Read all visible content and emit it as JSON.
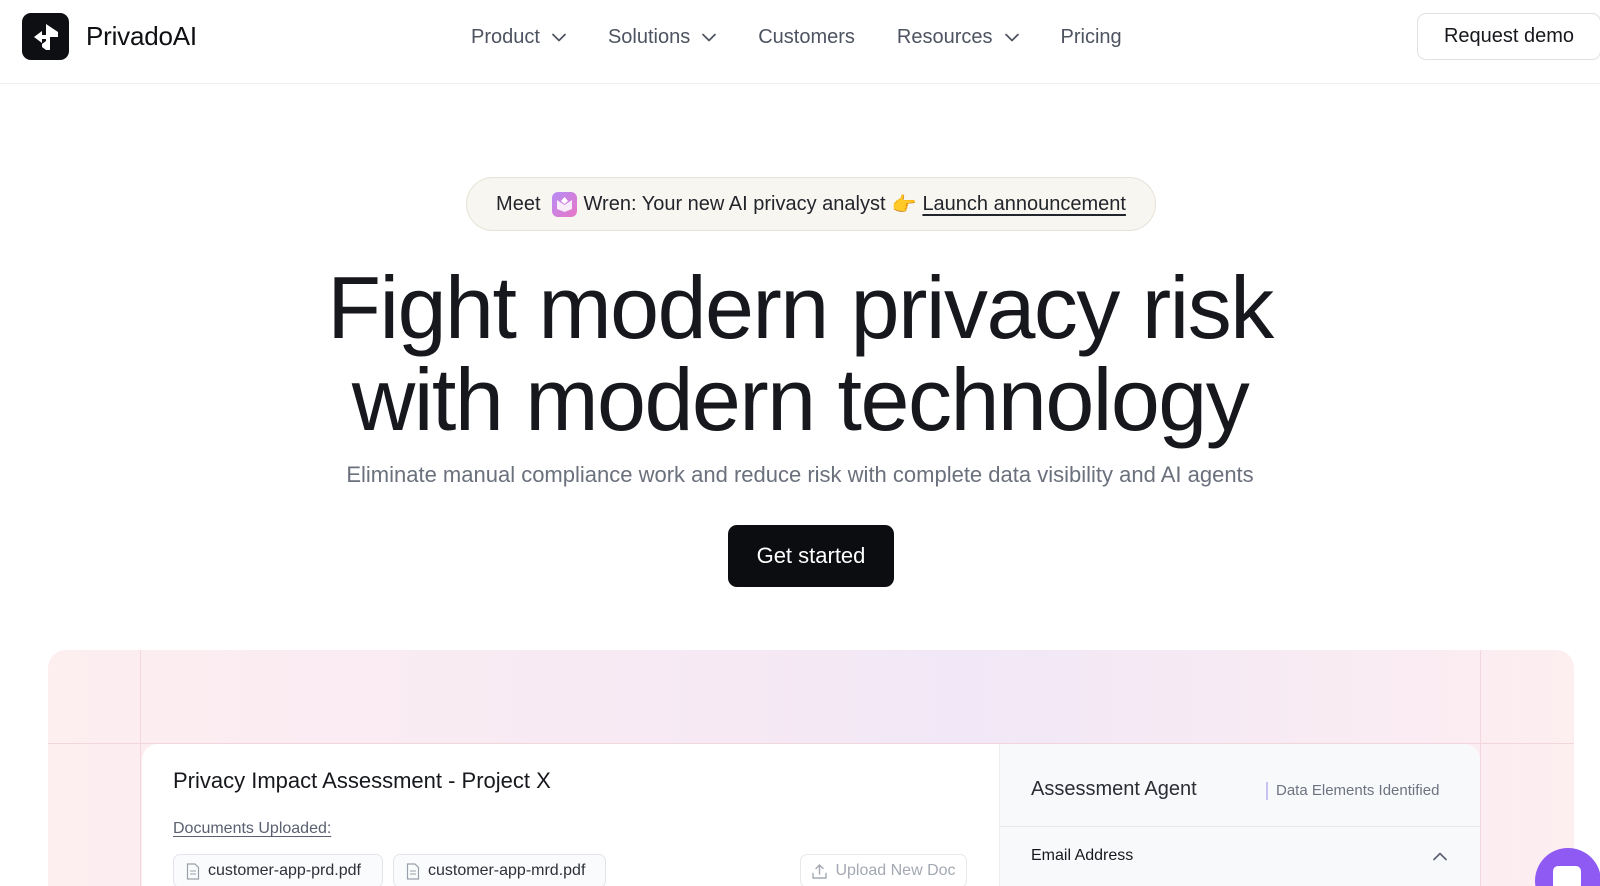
{
  "brand": {
    "name": "PrivadoAI"
  },
  "nav": {
    "items": [
      {
        "label": "Product",
        "has_dropdown": true
      },
      {
        "label": "Solutions",
        "has_dropdown": true
      },
      {
        "label": "Customers",
        "has_dropdown": false
      },
      {
        "label": "Resources",
        "has_dropdown": true
      },
      {
        "label": "Pricing",
        "has_dropdown": false
      }
    ],
    "request_demo": "Request demo"
  },
  "announcement": {
    "prefix": "Meet",
    "text": "Wren: Your new AI privacy analyst",
    "hand_emoji": "👉",
    "link": "Launch announcement"
  },
  "hero": {
    "title_line1": "Fight modern privacy risk",
    "title_line2": "with modern technology",
    "subtitle": "Eliminate manual compliance work and reduce risk with complete data visibility and AI agents",
    "cta": "Get started"
  },
  "preview": {
    "title": "Privacy Impact Assessment - Project X",
    "documents_label": "Documents Uploaded:",
    "files": [
      "customer-app-prd.pdf",
      "customer-app-mrd.pdf"
    ],
    "upload_label": "Upload New Doc",
    "agent": {
      "title": "Assessment Agent",
      "tag": "Data Elements Identified",
      "first_item": "Email Address"
    }
  },
  "colors": {
    "brand_dark": "#0b0d10",
    "chat_accent": "#8e5af3",
    "wren_gradient_start": "#b68cf5",
    "wren_gradient_end": "#e877c6"
  },
  "icons": [
    "chevron-down-icon",
    "file-icon",
    "upload-icon",
    "chevron-up-icon",
    "chat-icon",
    "wren-icon"
  ]
}
